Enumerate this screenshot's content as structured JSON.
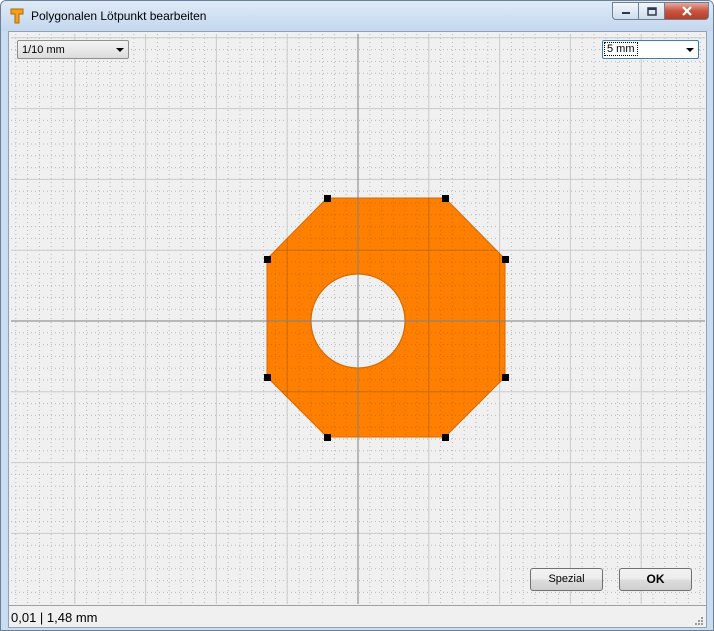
{
  "window": {
    "title": "Polygonalen Lötpunkt bearbeiten",
    "app_icon": "solder-pad-icon",
    "caption_buttons": [
      "minimize-icon",
      "maximize-icon",
      "close-icon"
    ]
  },
  "toolbar": {
    "precision_select": {
      "value": "1/10 mm"
    },
    "grid_select": {
      "value": "5 mm"
    }
  },
  "editor": {
    "pad_shape": "octagon",
    "pad_color": "#ff7f00",
    "pad_outline_color": "#d86a00",
    "hole_shape": "circle",
    "handle_color": "#000000",
    "grid_line_color": "#cccccc",
    "grid_dot_color": "#b8b8b8",
    "axis_color": "#808080",
    "background_color": "#f0f0f0"
  },
  "buttons": {
    "special_label": "Spezial",
    "ok_label": "OK"
  },
  "status": {
    "coordinates": "0,01 | 1,48 mm"
  }
}
